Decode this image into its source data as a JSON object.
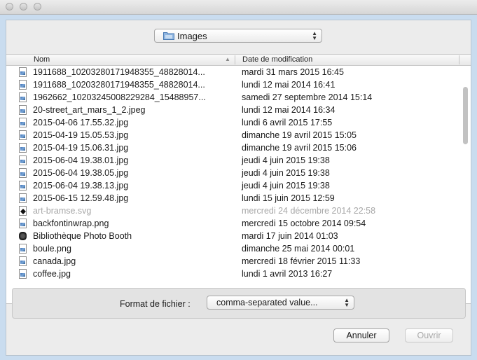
{
  "folder": {
    "label": "Images"
  },
  "columns": {
    "name": "Nom",
    "date": "Date de modification"
  },
  "files": [
    {
      "name": "1911688_10203280171948355_48828014...",
      "date": "mardi 31 mars 2015 16:45",
      "icon": "image-file-icon"
    },
    {
      "name": "1911688_10203280171948355_48828014...",
      "date": "lundi 12 mai 2014 16:41",
      "icon": "image-file-icon"
    },
    {
      "name": "1962662_10203245008229284_15488957...",
      "date": "samedi 27 septembre 2014 15:14",
      "icon": "image-file-icon"
    },
    {
      "name": "20-street_art_mars_1_2.jpeg",
      "date": "lundi 12 mai 2014 16:34",
      "icon": "image-file-icon"
    },
    {
      "name": "2015-04-06 17.55.32.jpg",
      "date": "lundi 6 avril 2015 17:55",
      "icon": "image-file-icon"
    },
    {
      "name": "2015-04-19 15.05.53.jpg",
      "date": "dimanche 19 avril 2015 15:05",
      "icon": "image-file-icon"
    },
    {
      "name": "2015-04-19 15.06.31.jpg",
      "date": "dimanche 19 avril 2015 15:06",
      "icon": "image-file-icon"
    },
    {
      "name": "2015-06-04 19.38.01.jpg",
      "date": "jeudi 4 juin 2015 19:38",
      "icon": "image-file-icon"
    },
    {
      "name": "2015-06-04 19.38.05.jpg",
      "date": "jeudi 4 juin 2015 19:38",
      "icon": "image-file-icon"
    },
    {
      "name": "2015-06-04 19.38.13.jpg",
      "date": "jeudi 4 juin 2015 19:38",
      "icon": "image-file-icon"
    },
    {
      "name": "2015-06-15 12.59.48.jpg",
      "date": "lundi 15 juin 2015 12:59",
      "icon": "image-file-icon"
    },
    {
      "name": "art-bramse.svg",
      "date": "mercredi 24 décembre 2014 22:58",
      "icon": "svg-file-icon",
      "disabled": true
    },
    {
      "name": "backfontinwrap.png",
      "date": "mercredi 15 octobre 2014 09:54",
      "icon": "image-file-icon"
    },
    {
      "name": "Bibliothèque Photo Booth",
      "date": "mardi 17 juin 2014 01:03",
      "icon": "photo-booth-library-icon"
    },
    {
      "name": "boule.png",
      "date": "dimanche 25 mai 2014 00:01",
      "icon": "image-file-icon"
    },
    {
      "name": "canada.jpg",
      "date": "mercredi 18 février 2015 11:33",
      "icon": "image-file-icon"
    },
    {
      "name": "coffee.jpg",
      "date": "lundi 1 avril 2013 16:27",
      "icon": "image-file-icon"
    }
  ],
  "format": {
    "label": "Format de fichier :",
    "value": "comma-separated value..."
  },
  "buttons": {
    "cancel": "Annuler",
    "open": "Ouvrir"
  }
}
